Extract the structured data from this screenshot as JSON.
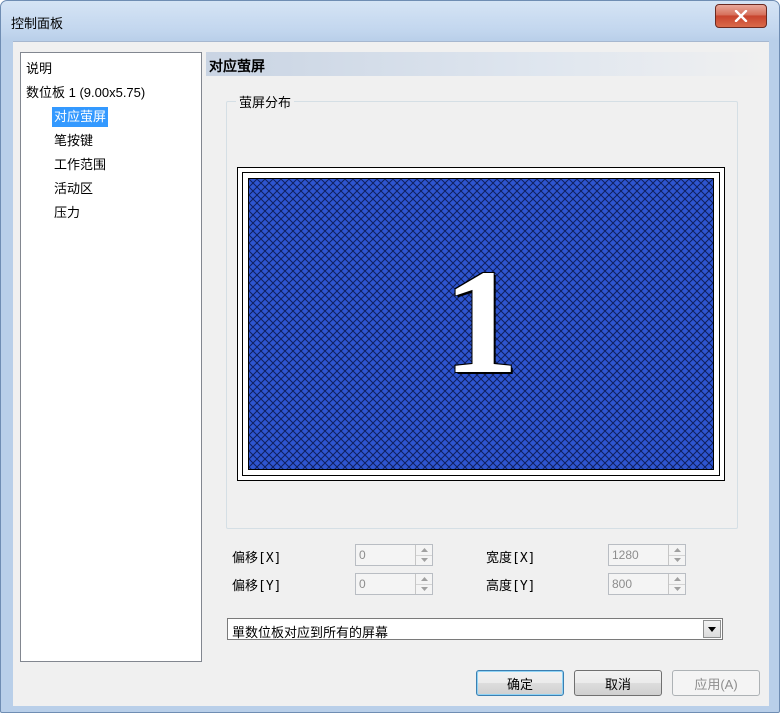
{
  "window": {
    "title": "控制面板",
    "close_label": "x"
  },
  "tree": {
    "items": [
      {
        "label": "说明"
      },
      {
        "label": "数位板  1 (9.00x5.75)"
      },
      {
        "label": "对应萤屏"
      },
      {
        "label": "笔按键"
      },
      {
        "label": "工作范围"
      },
      {
        "label": "活动区"
      },
      {
        "label": "压力"
      }
    ],
    "selected_index": 2
  },
  "page": {
    "title": "对应萤屏"
  },
  "screen_group": {
    "label": "萤屏分布",
    "monitor_number": "1",
    "screen_color": "#2e55d0"
  },
  "fields": {
    "offset_x": {
      "label": "偏移[X]",
      "value": "0"
    },
    "offset_y": {
      "label": "偏移[Y]",
      "value": "0"
    },
    "width_x": {
      "label": "宽度[X]",
      "value": "1280"
    },
    "height_y": {
      "label": "高度[Y]",
      "value": "800"
    }
  },
  "mapping_select": {
    "value": "單数位板对应到所有的屏幕"
  },
  "buttons": {
    "ok": "确定",
    "cancel": "取消",
    "apply": "应用(A)"
  }
}
